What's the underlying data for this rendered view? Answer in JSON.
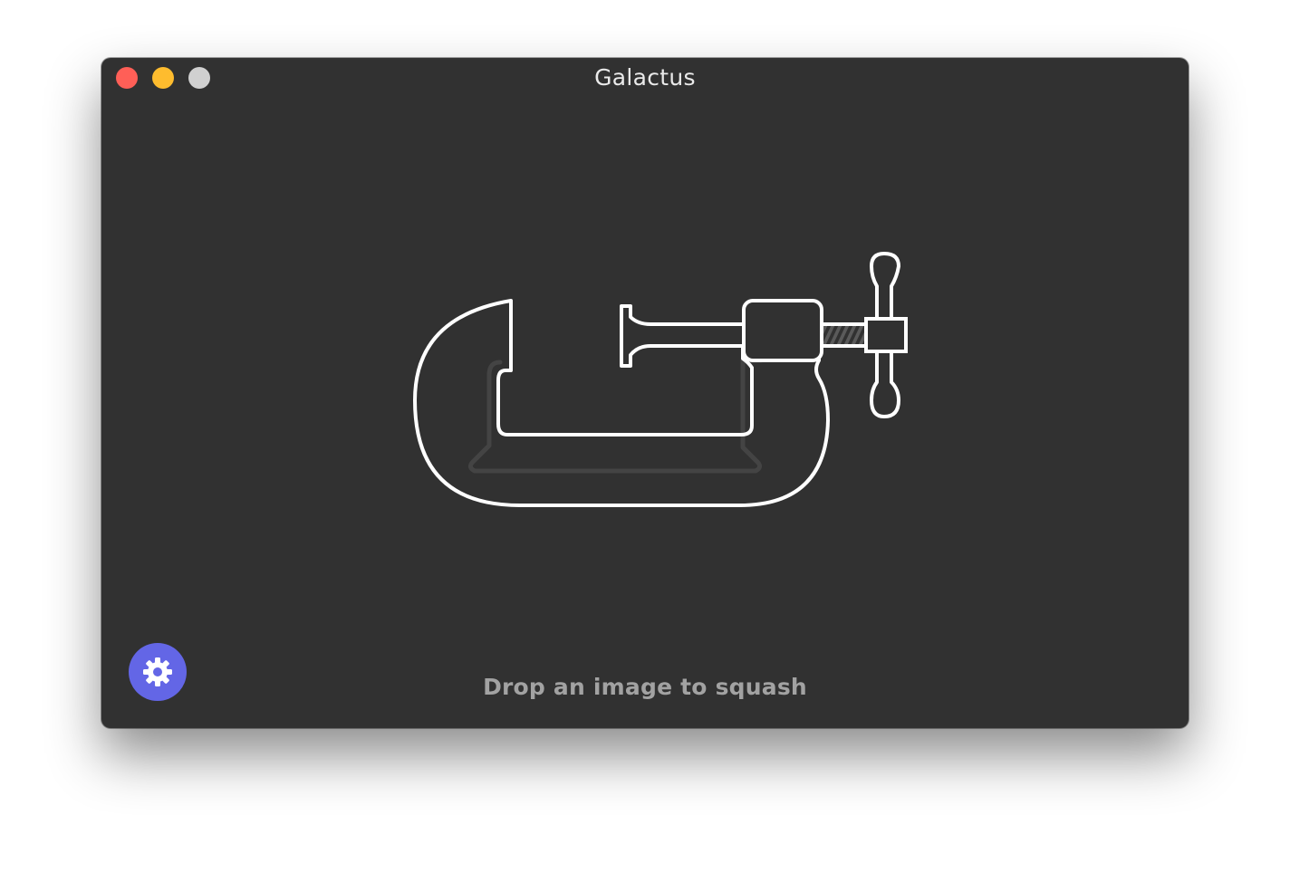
{
  "window": {
    "title": "Galactus",
    "background": "#313131"
  },
  "traffic_lights": {
    "close": {
      "color": "#ff5f57",
      "icon": "close-dot"
    },
    "minimize": {
      "color": "#febc2e",
      "icon": "minimize-dot"
    },
    "zoom": {
      "color": "#d0d0d0",
      "icon": "zoom-dot-disabled"
    }
  },
  "illustration": {
    "icon": "c-clamp-icon",
    "stroke_color": "#ffffff"
  },
  "settings": {
    "icon": "gear-icon",
    "accent": "#6366e6"
  },
  "drop_zone": {
    "hint": "Drop an image to squash"
  }
}
